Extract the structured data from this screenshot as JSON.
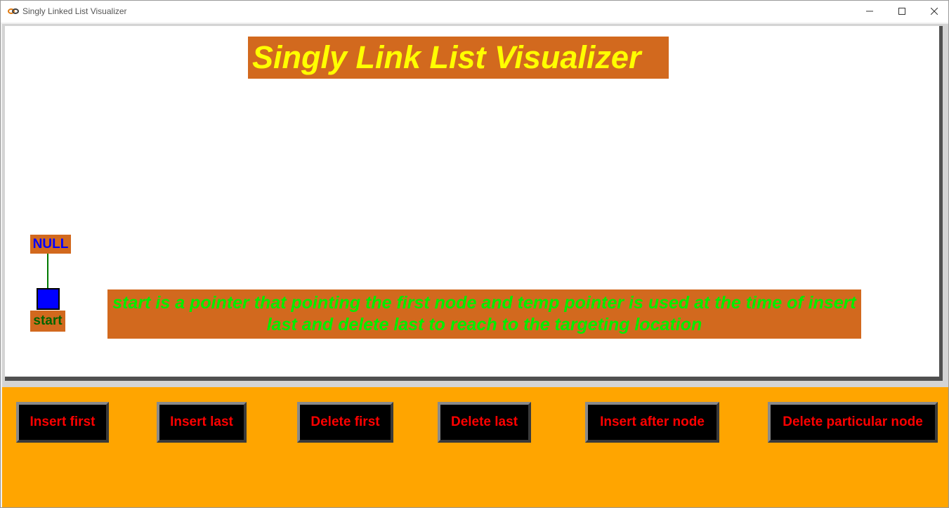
{
  "window": {
    "title": "Singly Linked List Visualizer",
    "icon": "link-chain-icon"
  },
  "canvas": {
    "heading": "Singly Link List Visualizer",
    "null_label": "NULL",
    "start_label": "start",
    "info_text": "start is a pointer that pointing the first node and temp pointer is used at the time of insert last and delete last to reach to the targeting location"
  },
  "buttons": {
    "insert_first": "Insert first",
    "insert_last": "Insert last",
    "delete_first": "Delete first",
    "delete_last": "Delete last",
    "insert_after_node": "Insert after node",
    "delete_particular_node": "Delete particular node"
  },
  "colors": {
    "heading_bg": "#d2691e",
    "heading_text": "#ffff00",
    "panel_bg": "#ffa500",
    "button_bg": "#000000",
    "button_text": "#ff0000",
    "info_text": "#00ee00",
    "node_fill": "#0000ff"
  }
}
